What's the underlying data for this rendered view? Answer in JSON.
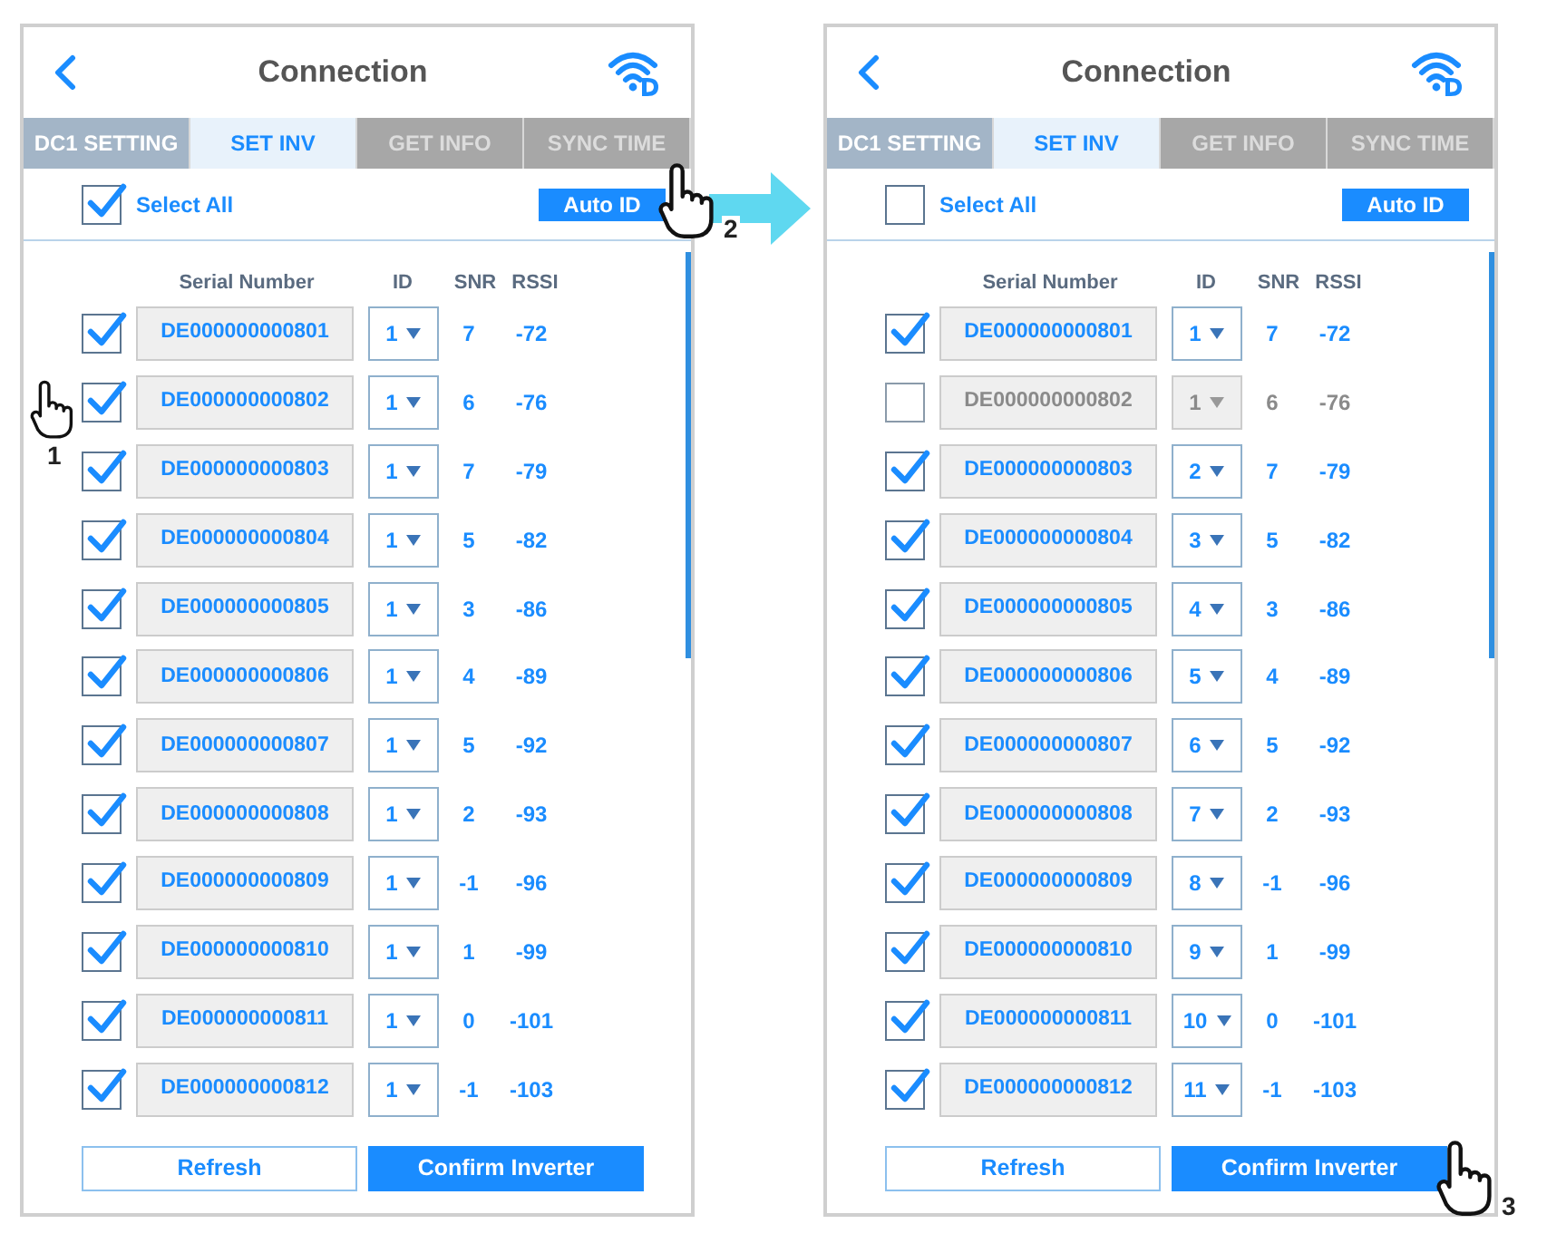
{
  "screens": [
    {
      "title": "Connection",
      "tabs": [
        {
          "label": "DC1 SETTING",
          "selected": false,
          "disabled": false
        },
        {
          "label": "SET INV",
          "selected": true,
          "disabled": false
        },
        {
          "label": "GET INFO",
          "selected": false,
          "disabled": true
        },
        {
          "label": "SYNC TIME",
          "selected": false,
          "disabled": true
        }
      ],
      "select_all": {
        "label": "Select All",
        "checked": true
      },
      "auto_id_button": {
        "label": "Auto ID",
        "callout": "2"
      },
      "columns": [
        "Serial Number",
        "ID",
        "SNR",
        "RSSI"
      ],
      "rows": [
        {
          "checked": true,
          "serial": "DE000000000801",
          "id": "1",
          "snr": "7",
          "rssi": "-72"
        },
        {
          "checked": true,
          "serial": "DE000000000802",
          "id": "1",
          "snr": "6",
          "rssi": "-76",
          "callout": "1"
        },
        {
          "checked": true,
          "serial": "DE000000000803",
          "id": "1",
          "snr": "7",
          "rssi": "-79"
        },
        {
          "checked": true,
          "serial": "DE000000000804",
          "id": "1",
          "snr": "5",
          "rssi": "-82"
        },
        {
          "checked": true,
          "serial": "DE000000000805",
          "id": "1",
          "snr": "3",
          "rssi": "-86"
        },
        {
          "checked": true,
          "serial": "DE000000000806",
          "id": "1",
          "snr": "4",
          "rssi": "-89"
        },
        {
          "checked": true,
          "serial": "DE000000000807",
          "id": "1",
          "snr": "5",
          "rssi": "-92"
        },
        {
          "checked": true,
          "serial": "DE000000000808",
          "id": "1",
          "snr": "2",
          "rssi": "-93"
        },
        {
          "checked": true,
          "serial": "DE000000000809",
          "id": "1",
          "snr": "-1",
          "rssi": "-96"
        },
        {
          "checked": true,
          "serial": "DE000000000810",
          "id": "1",
          "snr": "1",
          "rssi": "-99"
        },
        {
          "checked": true,
          "serial": "DE000000000811",
          "id": "1",
          "snr": "0",
          "rssi": "-101"
        },
        {
          "checked": true,
          "serial": "DE000000000812",
          "id": "1",
          "snr": "-1",
          "rssi": "-103"
        }
      ],
      "buttons": [
        {
          "label": "Refresh",
          "kind": "outline"
        },
        {
          "label": "Confirm Inverter",
          "kind": "primary"
        }
      ]
    },
    {
      "title": "Connection",
      "tabs": [
        {
          "label": "DC1 SETTING",
          "selected": false,
          "disabled": false
        },
        {
          "label": "SET INV",
          "selected": true,
          "disabled": false
        },
        {
          "label": "GET INFO",
          "selected": false,
          "disabled": true
        },
        {
          "label": "SYNC TIME",
          "selected": false,
          "disabled": true
        }
      ],
      "select_all": {
        "label": "Select All",
        "checked": false
      },
      "auto_id_button": {
        "label": "Auto ID"
      },
      "columns": [
        "Serial Number",
        "ID",
        "SNR",
        "RSSI"
      ],
      "rows": [
        {
          "checked": true,
          "serial": "DE000000000801",
          "id": "1",
          "snr": "7",
          "rssi": "-72"
        },
        {
          "checked": false,
          "serial": "DE000000000802",
          "id": "1",
          "snr": "6",
          "rssi": "-76"
        },
        {
          "checked": true,
          "serial": "DE000000000803",
          "id": "2",
          "snr": "7",
          "rssi": "-79"
        },
        {
          "checked": true,
          "serial": "DE000000000804",
          "id": "3",
          "snr": "5",
          "rssi": "-82"
        },
        {
          "checked": true,
          "serial": "DE000000000805",
          "id": "4",
          "snr": "3",
          "rssi": "-86"
        },
        {
          "checked": true,
          "serial": "DE000000000806",
          "id": "5",
          "snr": "4",
          "rssi": "-89"
        },
        {
          "checked": true,
          "serial": "DE000000000807",
          "id": "6",
          "snr": "5",
          "rssi": "-92"
        },
        {
          "checked": true,
          "serial": "DE000000000808",
          "id": "7",
          "snr": "2",
          "rssi": "-93"
        },
        {
          "checked": true,
          "serial": "DE000000000809",
          "id": "8",
          "snr": "-1",
          "rssi": "-96"
        },
        {
          "checked": true,
          "serial": "DE000000000810",
          "id": "9",
          "snr": "1",
          "rssi": "-99"
        },
        {
          "checked": true,
          "serial": "DE000000000811",
          "id": "10",
          "snr": "0",
          "rssi": "-101"
        },
        {
          "checked": true,
          "serial": "DE000000000812",
          "id": "11",
          "snr": "-1",
          "rssi": "-103"
        }
      ],
      "buttons": [
        {
          "label": "Refresh",
          "kind": "outline"
        },
        {
          "label": "Confirm Inverter",
          "kind": "primary",
          "callout": "3"
        }
      ]
    }
  ]
}
